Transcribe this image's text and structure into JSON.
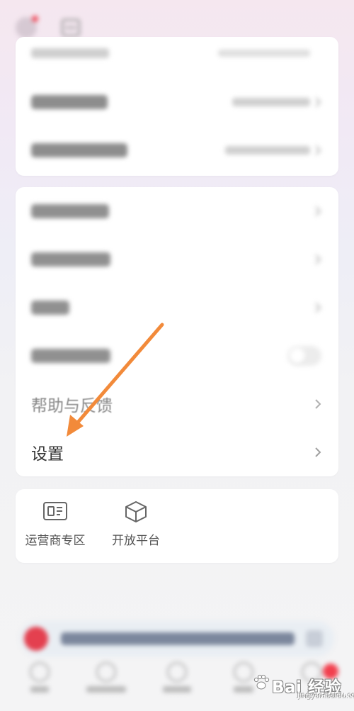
{
  "top_card": {
    "rows": [
      {
        "label": "",
        "value": ""
      },
      {
        "label": "",
        "value": ""
      },
      {
        "label": "",
        "value": ""
      }
    ]
  },
  "menu": {
    "rows": [
      {
        "label": "",
        "type": "chevron"
      },
      {
        "label": "",
        "type": "chevron"
      },
      {
        "label": "",
        "type": "chevron"
      },
      {
        "label": "",
        "type": "toggle",
        "enabled": false
      },
      {
        "label": "帮助与反馈",
        "type": "chevron"
      },
      {
        "label": "设置",
        "type": "chevron"
      }
    ]
  },
  "services": [
    {
      "label": "运营商专区",
      "icon": "sim-card-icon"
    },
    {
      "label": "开放平台",
      "icon": "cube-icon"
    }
  ],
  "banner": {
    "text": ""
  },
  "tabbar": {
    "tabs": [
      {
        "label": ""
      },
      {
        "label": ""
      },
      {
        "label": ""
      },
      {
        "label": ""
      },
      {
        "label": ""
      }
    ]
  },
  "watermark": {
    "text": "Bai  经验",
    "sub": "jingyan.baidu.com"
  },
  "colors": {
    "arrow": "#f28a3a",
    "card_bg": "#ffffff",
    "page_bg": "#f4f4f5",
    "badge_red": "#f04b5a",
    "text_primary": "#333333",
    "chevron": "#b0b0b0"
  }
}
